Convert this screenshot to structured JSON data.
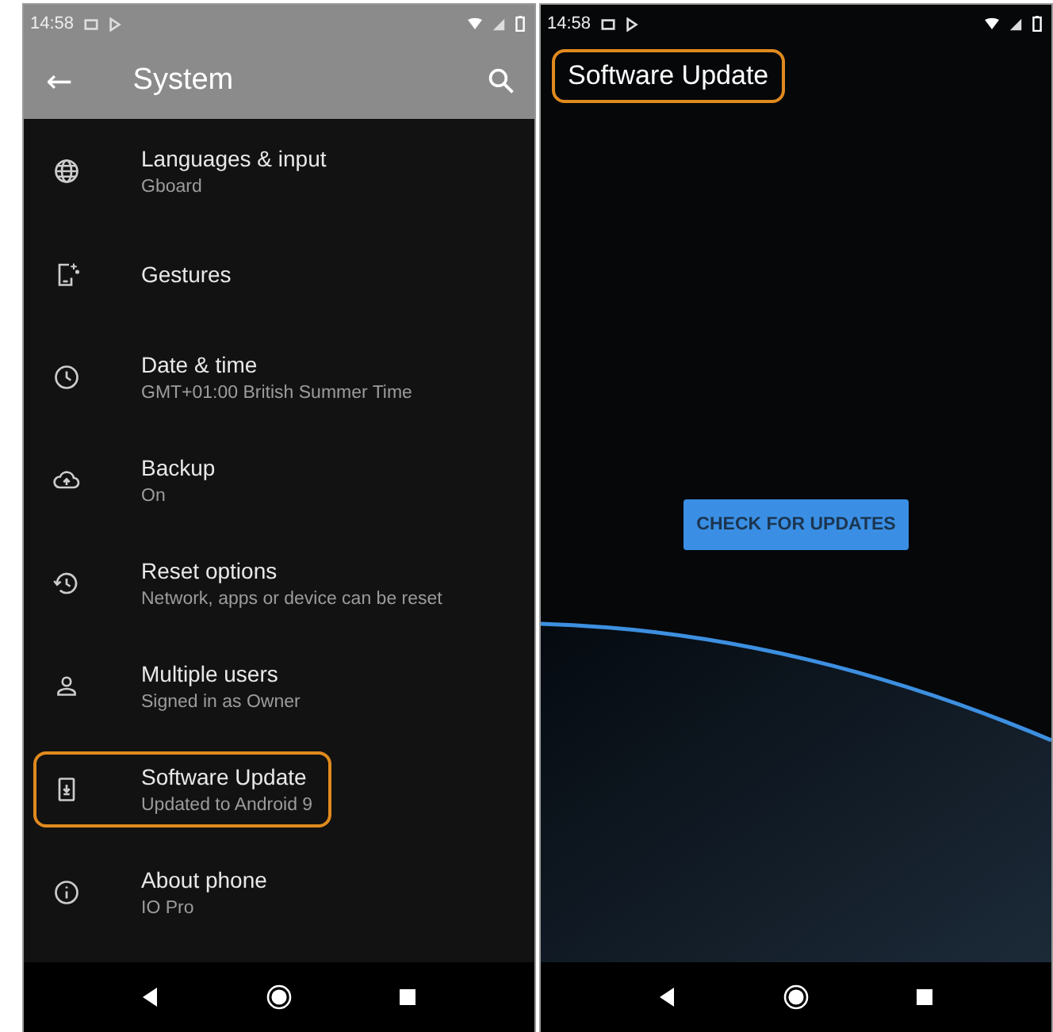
{
  "left_screen": {
    "status_bar": {
      "time": "14:58"
    },
    "app_bar": {
      "back": "←",
      "title": "System"
    },
    "settings": [
      {
        "title": "Languages & input",
        "summary": "Gboard",
        "highlighted": false
      },
      {
        "title": "Gestures",
        "highlighted": false
      },
      {
        "title": "Date & time",
        "summary": "GMT+01:00 British Summer Time",
        "highlighted": false
      },
      {
        "title": "Backup",
        "summary": "On",
        "highlighted": false
      },
      {
        "title": "Reset options",
        "summary": "Network, apps or device can be reset",
        "highlighted": false
      },
      {
        "title": "Multiple users",
        "summary": "Signed in as Owner",
        "highlighted": false
      },
      {
        "title": "Software Update",
        "summary": "Updated to Android 9",
        "highlighted": true
      },
      {
        "title": "About phone",
        "summary": "IO Pro",
        "highlighted": false
      }
    ]
  },
  "right_screen": {
    "status_bar": {
      "time": "14:58"
    },
    "title": {
      "text": "Software Update",
      "highlighted": true
    },
    "button": "CHECK FOR UPDATES"
  }
}
